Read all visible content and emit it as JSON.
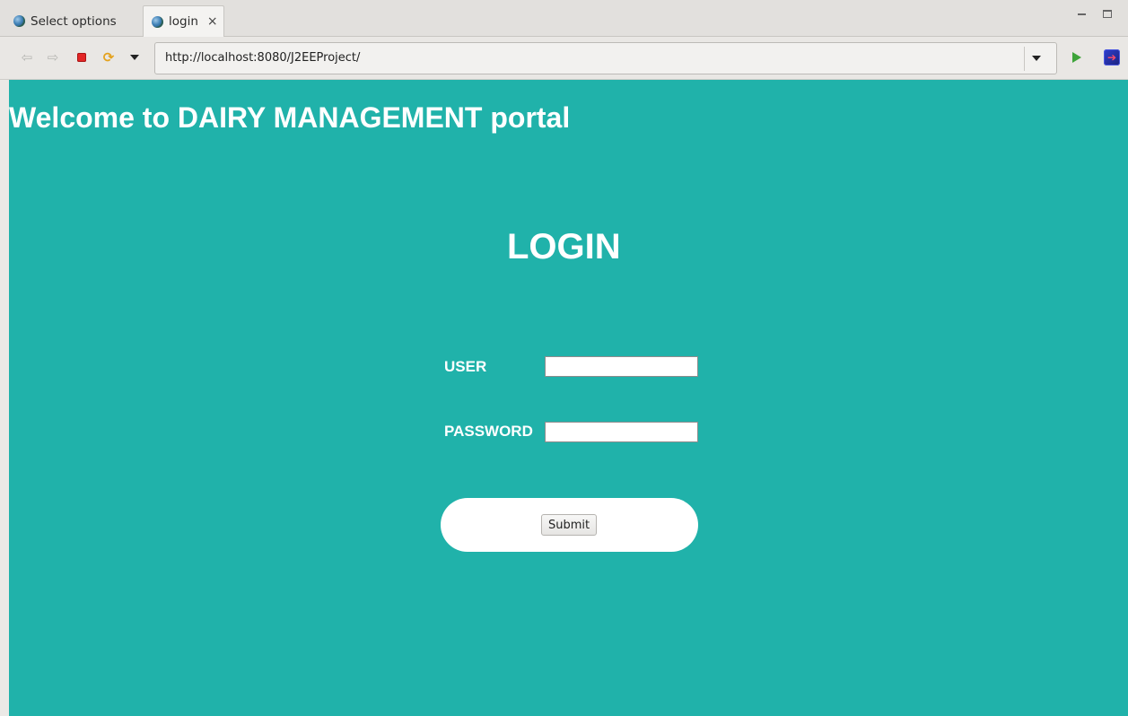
{
  "tabs": [
    {
      "label": "Select options",
      "icon": "globe-icon"
    },
    {
      "label": "login",
      "icon": "globe-icon",
      "close": "×",
      "active": true
    }
  ],
  "toolbar": {
    "url": "http://localhost:8080/J2EEProject/",
    "icons": [
      "back-arrow-icon",
      "forward-arrow-icon",
      "stop-icon",
      "refresh-icon",
      "dropdown-icon",
      "go-icon",
      "extension-icon"
    ]
  },
  "page": {
    "welcome": "Welcome to DAIRY MANAGEMENT portal",
    "title": "LOGIN",
    "user_label": "USER",
    "user_value": "",
    "password_label": "PASSWORD",
    "password_value": "",
    "submit_label": "Submit"
  },
  "colors": {
    "page_background": "#20b2aa",
    "text": "#ffffff"
  }
}
